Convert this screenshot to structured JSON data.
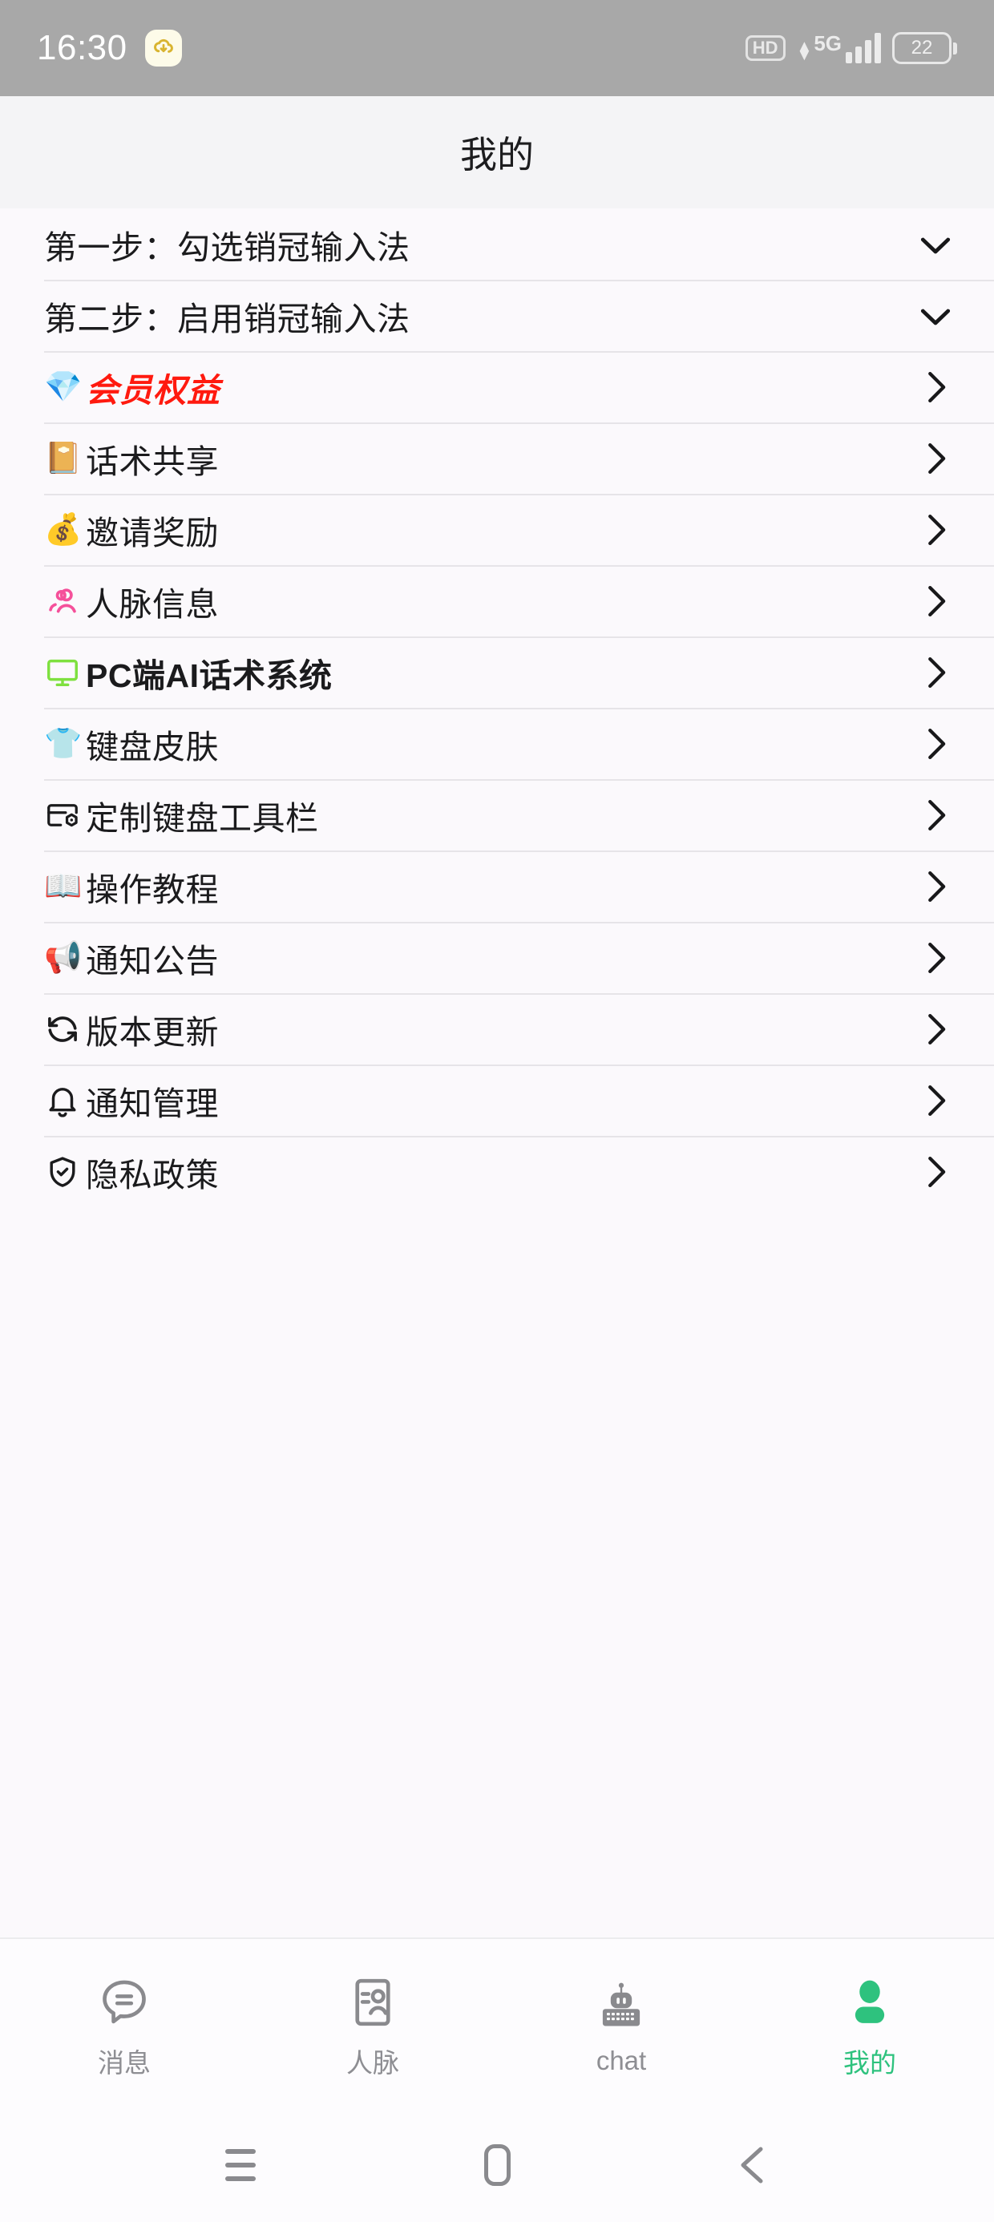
{
  "status_bar": {
    "time": "16:30",
    "app_icon": "cloud-app-icon",
    "hd_label": "HD",
    "network_type": "5G",
    "signal_bars": 4,
    "battery_level": "22"
  },
  "header": {
    "title": "我的"
  },
  "list": {
    "items": [
      {
        "label": "第一步：勾选销冠输入法",
        "icon": "",
        "icon_name": "none",
        "accessory": "check",
        "style": "plain"
      },
      {
        "label": "第二步：启用销冠输入法",
        "icon": "",
        "icon_name": "none",
        "accessory": "check",
        "style": "plain"
      },
      {
        "label": "会员权益",
        "icon": "💎",
        "icon_name": "gem-icon",
        "accessory": "chevron",
        "style": "vip"
      },
      {
        "label": "话术共享",
        "icon": "📔",
        "icon_name": "notebook-icon",
        "accessory": "chevron",
        "style": "plain"
      },
      {
        "label": "邀请奖励",
        "icon": "💰",
        "icon_name": "gold-bars-icon",
        "accessory": "chevron",
        "style": "plain"
      },
      {
        "label": "人脉信息",
        "icon": "",
        "icon_name": "people-network-icon",
        "accessory": "chevron",
        "style": "plain"
      },
      {
        "label": "PC端AI话术系统",
        "icon": "",
        "icon_name": "monitor-icon",
        "accessory": "chevron",
        "style": "bold"
      },
      {
        "label": "键盘皮肤",
        "icon": "👕",
        "icon_name": "tshirt-icon",
        "accessory": "chevron",
        "style": "plain"
      },
      {
        "label": "定制键盘工具栏",
        "icon": "",
        "icon_name": "keyboard-toolbar-icon",
        "accessory": "chevron",
        "style": "plain"
      },
      {
        "label": "操作教程",
        "icon": "📖",
        "icon_name": "open-book-icon",
        "accessory": "chevron",
        "style": "plain"
      },
      {
        "label": "通知公告",
        "icon": "📢",
        "icon_name": "megaphone-icon",
        "accessory": "chevron",
        "style": "plain"
      },
      {
        "label": "版本更新",
        "icon": "",
        "icon_name": "refresh-icon",
        "accessory": "chevron",
        "style": "plain"
      },
      {
        "label": "通知管理",
        "icon": "",
        "icon_name": "bell-icon",
        "accessory": "chevron",
        "style": "plain"
      },
      {
        "label": "隐私政策",
        "icon": "",
        "icon_name": "shield-check-icon",
        "accessory": "chevron",
        "style": "plain"
      }
    ]
  },
  "tabbar": {
    "tabs": [
      {
        "label": "消息",
        "icon_name": "chat-bubble-icon",
        "active": false
      },
      {
        "label": "人脉",
        "icon_name": "contact-card-icon",
        "active": false
      },
      {
        "label": "chat",
        "icon_name": "robot-keyboard-icon",
        "active": false
      },
      {
        "label": "我的",
        "icon_name": "person-icon",
        "active": true
      }
    ]
  },
  "navbar": {
    "recents_label": "recents-icon",
    "home_label": "home-icon",
    "back_label": "back-icon"
  },
  "colors": {
    "accent_green": "#2ec27e",
    "vip_red": "#ff1a0f",
    "statusbar_gray": "#a8a8a8",
    "header_gray": "#f4f4f6",
    "page_bg": "#fbf9fc",
    "divider": "#e6e4e8",
    "text_primary": "#1b1b1d",
    "text_muted": "#8e8e93"
  }
}
